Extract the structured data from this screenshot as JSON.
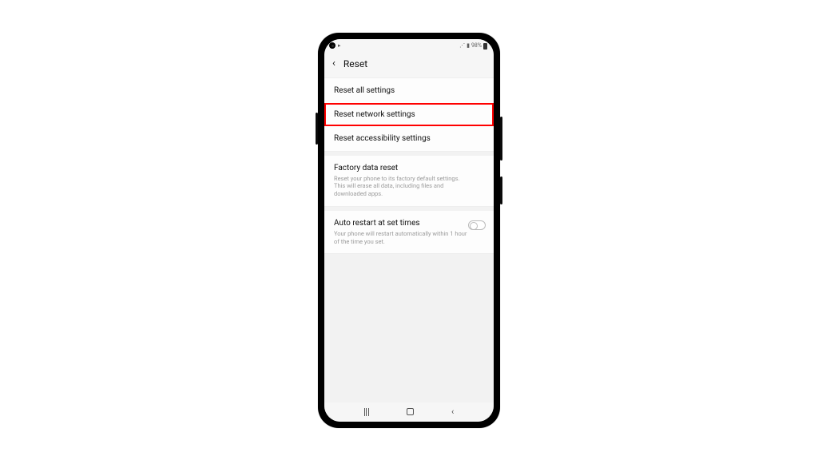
{
  "statusbar": {
    "battery_pct": "98%"
  },
  "header": {
    "title": "Reset"
  },
  "items": {
    "reset_all": {
      "label": "Reset all settings"
    },
    "reset_network": {
      "label": "Reset network settings"
    },
    "reset_accessibility": {
      "label": "Reset accessibility settings"
    },
    "factory": {
      "label": "Factory data reset",
      "desc": "Reset your phone to its factory default settings. This will erase all data, including files and downloaded apps."
    },
    "auto_restart": {
      "label": "Auto restart at set times",
      "desc": "Your phone will restart automatically within 1 hour of the time you set."
    }
  }
}
